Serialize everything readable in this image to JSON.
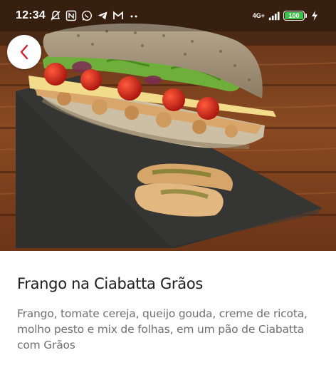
{
  "status_bar": {
    "time": "12:34",
    "network_label": "4G+",
    "battery_level": "100",
    "icons": [
      "mute-bell-icon",
      "nfc-icon",
      "whatsapp-icon",
      "telegram-icon",
      "gmail-icon",
      "more-dots-icon",
      "signal-icon",
      "charging-bolt-icon"
    ]
  },
  "header": {
    "back_icon": "chevron-left-icon",
    "accent_color": "#d61f2b"
  },
  "product": {
    "image": "sandwich-photo",
    "name": "Frango na Ciabatta Grãos",
    "description": "Frango, tomate cereja, queijo gouda, creme de ricota, molho pesto e mix de folhas, em um pão de Ciabatta com Grãos"
  }
}
